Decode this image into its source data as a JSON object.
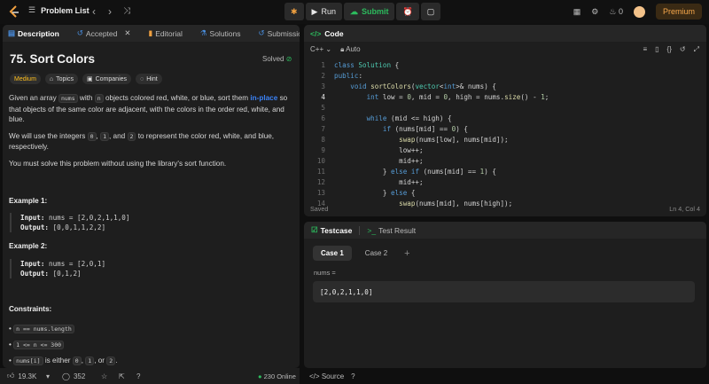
{
  "topbar": {
    "problem_list": "Problem List",
    "run": "Run",
    "submit": "Submit",
    "fire_count": "0",
    "premium": "Premium"
  },
  "left": {
    "tabs": [
      {
        "label": "Description"
      },
      {
        "label": "Accepted"
      },
      {
        "label": "Editorial"
      },
      {
        "label": "Solutions"
      },
      {
        "label": "Submissions"
      }
    ],
    "title": "75. Sort Colors",
    "solved": "Solved",
    "badges": [
      "Medium",
      "Topics",
      "Companies",
      "Hint"
    ],
    "p1_a": "Given an array ",
    "p1_code1": "nums",
    "p1_b": " with ",
    "p1_code2": "n",
    "p1_c": " objects colored red, white, or blue, sort them ",
    "p1_link": "in-place",
    "p1_d": " so that objects of the same color are adjacent, with the colors in the order red, white, and blue.",
    "p2_a": "We will use the integers ",
    "p2_c0": "0",
    "p2_b": ", ",
    "p2_c1": "1",
    "p2_c": ", and ",
    "p2_c2": "2",
    "p2_d": " to represent the color red, white, and blue, respectively.",
    "p3": "You must solve this problem without using the library's sort function.",
    "ex1_title": "Example 1:",
    "ex1_input_label": "Input:",
    "ex1_input": "nums = [2,0,2,1,1,0]",
    "ex1_output_label": "Output:",
    "ex1_output": "[0,0,1,1,2,2]",
    "ex2_title": "Example 2:",
    "ex2_input_label": "Input:",
    "ex2_input": "nums = [2,0,1]",
    "ex2_output_label": "Output:",
    "ex2_output": "[0,1,2]",
    "constraints_title": "Constraints:",
    "c1": "n == nums.length",
    "c2": "1 <= n <= 300",
    "c3_code": "nums[i]",
    "c3_a": " is either ",
    "c3_0": "0",
    "c3_b": ", ",
    "c3_1": "1",
    "c3_c": ", or ",
    "c3_2": "2",
    "c3_d": ".",
    "likes": "19.3K",
    "comments": "352",
    "online": "230 Online"
  },
  "code": {
    "header": "Code",
    "language": "C++",
    "auto": "Auto",
    "lines": [
      {
        "n": "1"
      },
      {
        "n": "2"
      },
      {
        "n": "3"
      },
      {
        "n": "4"
      },
      {
        "n": "5"
      },
      {
        "n": "6"
      },
      {
        "n": "7"
      },
      {
        "n": "8"
      },
      {
        "n": "9"
      },
      {
        "n": "10"
      },
      {
        "n": "11"
      },
      {
        "n": "12"
      },
      {
        "n": "13"
      },
      {
        "n": "14"
      }
    ],
    "saved": "Saved",
    "cursor": "Ln 4, Col 4"
  },
  "test": {
    "tab1": "Testcase",
    "tab2": "Test Result",
    "case1": "Case 1",
    "case2": "Case 2",
    "add": "+",
    "var_label": "nums =",
    "var_value": "[2,0,2,1,1,0]",
    "source": "Source"
  }
}
